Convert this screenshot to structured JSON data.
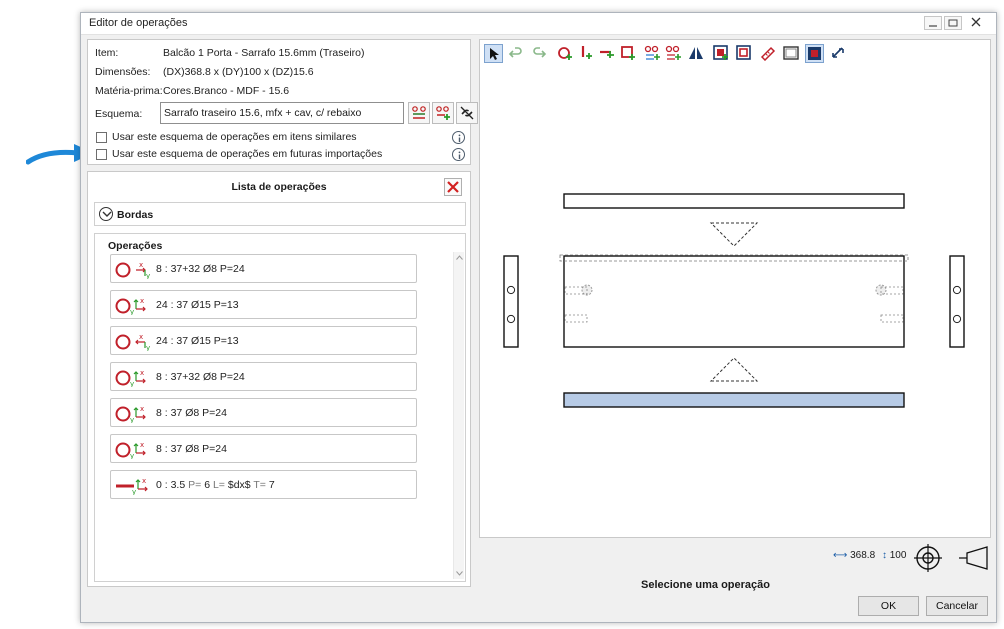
{
  "window": {
    "title": "Editor de operações"
  },
  "info": {
    "item_label": "Item:",
    "item_value": "Balcão 1 Porta - Sarrafo 15.6mm (Traseiro)",
    "dims_label": "Dimensões:",
    "dims_value": "(DX)368.8 x (DY)100 x (DZ)15.6",
    "material_label": "Matéria-prima:",
    "material_value": "Cores.Branco - MDF - 15.6",
    "schema_label": "Esquema:",
    "schema_value": "Sarrafo traseiro 15.6, mfx + cav, c/ rebaixo",
    "check_similar": "Usar este esquema de operações em itens similares",
    "check_future": "Usar este esquema de operações em futuras importações"
  },
  "operations": {
    "title": "Lista de operações",
    "bordas_label": "Bordas",
    "header": "Operações",
    "items": [
      {
        "text": "8 : 37+32 Ø8 P=24"
      },
      {
        "text": "24 : 37 Ø15 P=13"
      },
      {
        "text": "24 : 37 Ø15 P=13"
      },
      {
        "text": "8 : 37+32 Ø8 P=24"
      },
      {
        "text": "8 : 37 Ø8 P=24"
      },
      {
        "text": "8 : 37 Ø8 P=24"
      }
    ],
    "groove": {
      "a": "0 : 3.5",
      "b": "P=",
      "c": "6",
      "d": "L=",
      "e": "$dx$",
      "f": "T=",
      "g": "7"
    }
  },
  "toolbar": {
    "icons": [
      "cursor-icon",
      "undo-icon",
      "redo-icon",
      "add-hole-icon",
      "add-vertical-groove-icon",
      "add-horizontal-groove-icon",
      "add-pocket-icon",
      "add-hole-pattern-icon",
      "add-hole-pattern-alt-icon",
      "mirror-icon",
      "add-cutout-icon",
      "frame-icon",
      "measure-icon",
      "rectangle-icon",
      "zoom-fit-icon",
      "swap-icon"
    ]
  },
  "viewer": {
    "dim_x": "368.8",
    "dim_y": "100",
    "status": "Selecione uma operação"
  },
  "buttons": {
    "ok": "OK",
    "cancel": "Cancelar"
  },
  "colors": {
    "accent": "#1e88d8",
    "hole_red": "#c0202a",
    "selected_face": "#b7cbe6",
    "delete_red": "#d22020"
  }
}
